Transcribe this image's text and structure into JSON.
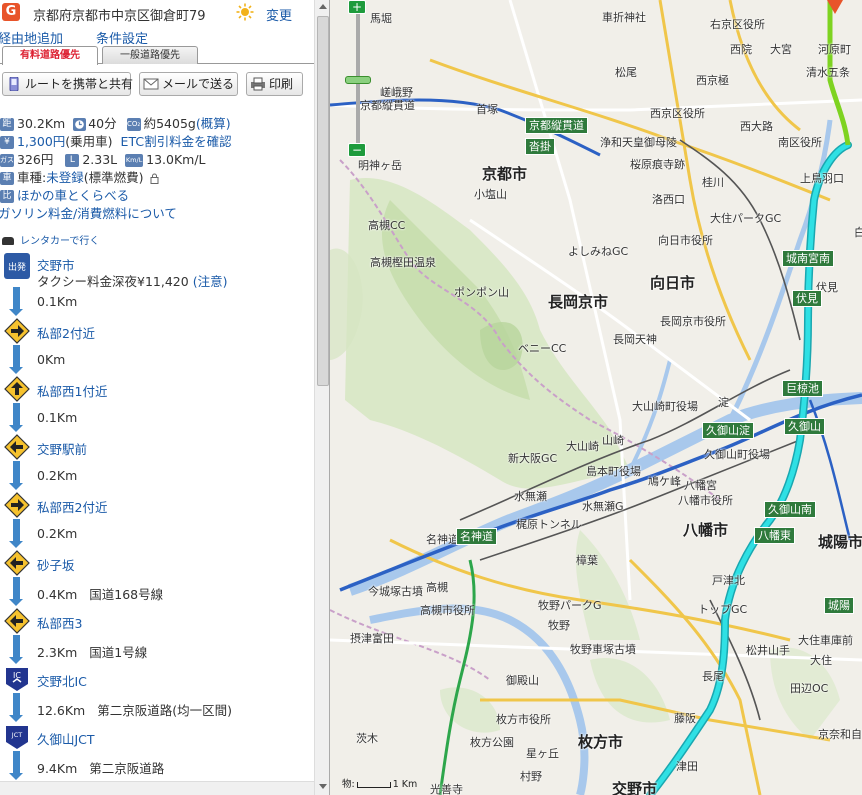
{
  "header": {
    "logo_letter": "G",
    "destination": "京都府京都市中京区御倉町79",
    "change_label": "変更"
  },
  "subheader": {
    "add_waypoint": "経由地追加",
    "conditions": "条件設定"
  },
  "tabs": [
    {
      "label": "有料道路優先",
      "active": true
    },
    {
      "label": "一般道路優先",
      "active": false
    }
  ],
  "toolbar": {
    "share_label": "ルートを携帯と共有",
    "mail_label": "メールで送る",
    "print_label": "印刷"
  },
  "summary": {
    "distance_badge": "距",
    "distance": "30.2Km",
    "time": "40分",
    "co2_badge": "CO₂",
    "co2": "約5405g",
    "co2_link": "(概算)",
    "toll_badge": "¥",
    "toll": "1,300円",
    "toll_note": "(乗用車)",
    "etc_link": "ETC割引料金を確認",
    "fuel_badge": "ガス",
    "fuel_cost": "326円",
    "liters_badge": "L",
    "liters": "2.33L",
    "kml_badge": "Km/L",
    "kml": "13.0Km/L",
    "vehicle_badge": "車",
    "vehicle_prefix": "車種:",
    "vehicle_link": "未登録",
    "vehicle_suffix": "(標準燃費)",
    "compare_badge": "比",
    "compare_link": "ほかの車とくらべる",
    "gas_link": "ガソリン料金/消費燃料について"
  },
  "rental_label": "レンタカーで行く",
  "start": {
    "badge": "出発",
    "name": "交野市",
    "taxi_text": "タクシー料金深夜¥11,420",
    "taxi_note": "(注意)"
  },
  "steps": [
    {
      "dist": "0.1Km",
      "name": "私部2付近",
      "icon": "right",
      "road": ""
    },
    {
      "dist": "0Km",
      "name": "私部西1付近",
      "icon": "up",
      "road": ""
    },
    {
      "dist": "0.1Km",
      "name": "交野駅前",
      "icon": "left",
      "road": ""
    },
    {
      "dist": "0.2Km",
      "name": "私部西2付近",
      "icon": "right",
      "road": ""
    },
    {
      "dist": "0.2Km",
      "name": "砂子坂",
      "icon": "left",
      "road": ""
    },
    {
      "dist": "0.4Km",
      "name": "私部西3",
      "icon": "left",
      "road": "国道168号線"
    },
    {
      "dist": "2.3Km",
      "name": "交野北IC",
      "icon": "ic",
      "road": "国道1号線"
    },
    {
      "dist": "12.6Km",
      "name": "久御山JCT",
      "icon": "jct",
      "road": "第二京阪道路(均一区間)"
    },
    {
      "dist": "9.4Km",
      "name": "",
      "icon": "",
      "road": "第二京阪道路"
    }
  ],
  "icon_labels": {
    "ic": "IC",
    "jct": "JCT"
  },
  "map": {
    "zoom_plus": "+",
    "zoom_minus": "−",
    "scale_prefix": "物:",
    "scale_label": "1 Km",
    "big_labels": [
      "京都市",
      "長岡京市",
      "向日市",
      "八幡市",
      "城陽市",
      "枚方市",
      "交野市"
    ],
    "labels": [
      "馬堀",
      "右京区役所",
      "西院",
      "大宮",
      "河原町",
      "清水五条",
      "松尾",
      "西京極",
      "京都縦貫道",
      "西京区役所",
      "西大路",
      "南区役所",
      "浄和天皇御母陵",
      "桜原痕寺跡",
      "明神ヶ岳",
      "小塩山",
      "洛西口",
      "桂川",
      "上鳥羽口",
      "向日市役所",
      "高槻CC",
      "よしみねGC",
      "白河天皇陵",
      "高槻樫田温泉",
      "ポンポン山",
      "長岡京市役所",
      "長岡天神",
      "伏見",
      "ベニーCC",
      "大山崎町役場",
      "淀",
      "大山崎",
      "山崎",
      "島本町役場",
      "鳩ケ峰",
      "八幡宮",
      "久御山町役場",
      "八幡市役所",
      "新大阪GC",
      "水無瀬",
      "水無瀬G",
      "梶原トンネル",
      "名神道",
      "樟葉",
      "今城塚古墳",
      "高槻",
      "高槻市役所",
      "牧野パークG",
      "摂津富田",
      "戸津北",
      "トップGC",
      "松井山手",
      "大住",
      "大住車庫前",
      "牧野",
      "牧野車塚古墳",
      "御殿山",
      "長尾",
      "藤阪",
      "田辺OC",
      "枚方市役所",
      "枚方公園",
      "星ヶ丘",
      "村野",
      "光善寺",
      "茨木",
      "津田",
      "京奈和自動車道",
      "車折神社",
      "大住パークGC",
      "首塚",
      "嵯峨野"
    ],
    "signs": [
      "沓掛",
      "京都縦貫道",
      "城南宮南",
      "伏見",
      "巨椋池",
      "久御山淀",
      "久御山",
      "久御山南",
      "八幡東",
      "名神道",
      "城陽"
    ]
  },
  "route_color": "#29d4d8",
  "link_color": "#1a5aa8",
  "accent_color": "#e8542a"
}
